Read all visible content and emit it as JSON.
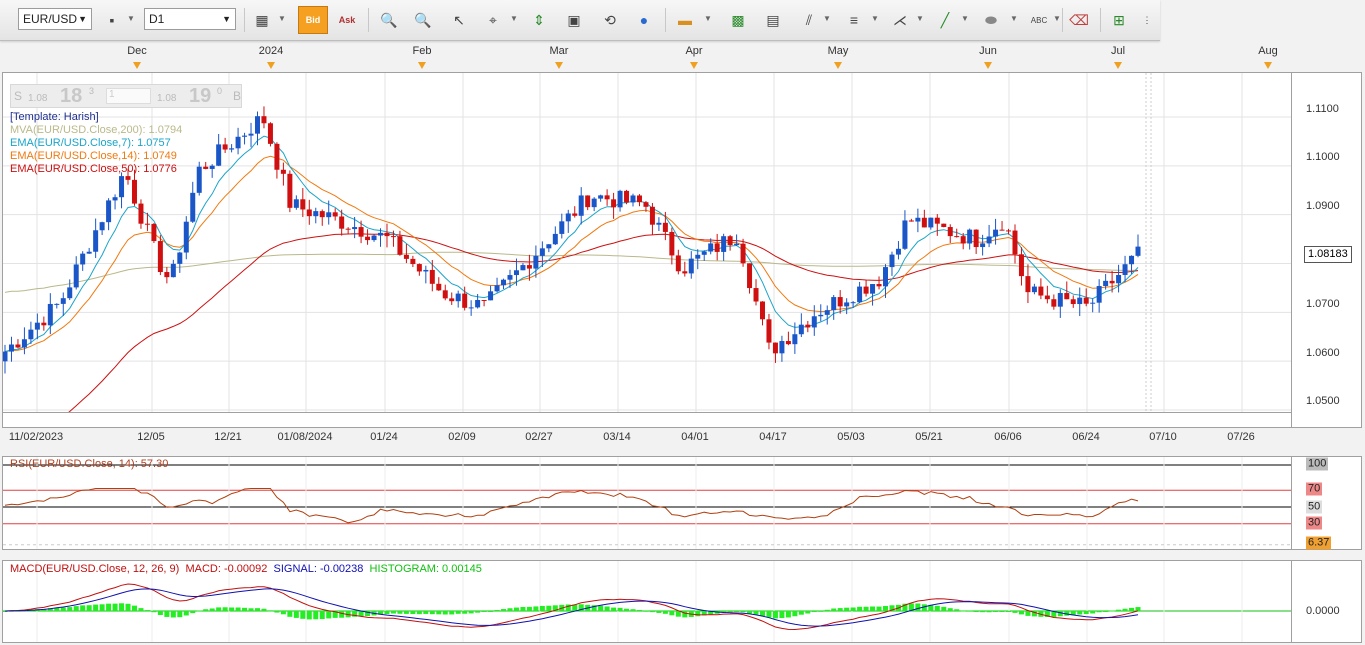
{
  "toolbar": {
    "symbol": "EUR/USD",
    "timeframe": "D1",
    "bid_label": "Bid",
    "ask_label": "Ask"
  },
  "timeline": {
    "months": [
      "Dec",
      "2024",
      "Feb",
      "Mar",
      "Apr",
      "May",
      "Jun",
      "Jul",
      "Aug"
    ]
  },
  "quote": {
    "sell_label": "S",
    "sell_small": "1.08",
    "sell_big": "18",
    "sell_sup": "3",
    "amount": "1",
    "buy_small": "1.08",
    "buy_big": "19",
    "buy_sup": "0",
    "buy_label": "B"
  },
  "price_chart": {
    "legend": [
      {
        "text": "[Template: Harish]",
        "color": "#1f2f8f"
      },
      {
        "text": "MVA(EUR/USD.Close,200): 1.0794",
        "color": "#b9b98a"
      },
      {
        "text": "EMA(EUR/USD.Close,7): 1.0757",
        "color": "#1aa4c9"
      },
      {
        "text": "EMA(EUR/USD.Close,14): 1.0749",
        "color": "#f07a10"
      },
      {
        "text": "EMA(EUR/USD.Close,50): 1.0776",
        "color": "#cc1111"
      }
    ],
    "current_price": "1.08183",
    "y_ticks": [
      "1.1100",
      "1.1000",
      "1.0900",
      "1.0800",
      "1.0700",
      "1.0600",
      "1.0500"
    ],
    "x_ticks": [
      "11/02/2023",
      "12/05",
      "12/21",
      "01/08/2024",
      "01/24",
      "02/09",
      "02/27",
      "03/14",
      "04/01",
      "04/17",
      "05/03",
      "05/21",
      "06/06",
      "06/24",
      "07/10",
      "07/26"
    ]
  },
  "rsi": {
    "label": "RSI(EUR/USD.Close, 14): 57.30",
    "levels": [
      "100",
      "70",
      "50",
      "30"
    ],
    "current": "6.37"
  },
  "macd": {
    "label": "MACD(EUR/USD.Close, 12, 26, 9)",
    "macd_value": "MACD: -0.00092",
    "signal_value": "SIGNAL: -0.00238",
    "histogram_value": "HISTOGRAM: 0.00145",
    "zero_label": "0.0000"
  },
  "chart_data": {
    "type": "candlestick",
    "symbol": "EUR/USD",
    "timeframe": "D1",
    "y_range": [
      1.05,
      1.115
    ],
    "x_range": [
      "2023-11-02",
      "2024-07-31"
    ],
    "closes_approx": [
      {
        "date": "2023-11-02",
        "close": 1.062
      },
      {
        "date": "2023-11-14",
        "close": 1.072
      },
      {
        "date": "2023-11-28",
        "close": 1.099
      },
      {
        "date": "2023-12-05",
        "close": 1.081
      },
      {
        "date": "2023-12-08",
        "close": 1.076
      },
      {
        "date": "2023-12-14",
        "close": 1.099
      },
      {
        "date": "2023-12-28",
        "close": 1.11
      },
      {
        "date": "2024-01-03",
        "close": 1.092
      },
      {
        "date": "2024-01-16",
        "close": 1.088
      },
      {
        "date": "2024-01-24",
        "close": 1.085
      },
      {
        "date": "2024-02-05",
        "close": 1.074
      },
      {
        "date": "2024-02-14",
        "close": 1.071
      },
      {
        "date": "2024-02-27",
        "close": 1.084
      },
      {
        "date": "2024-03-08",
        "close": 1.094
      },
      {
        "date": "2024-03-20",
        "close": 1.092
      },
      {
        "date": "2024-03-28",
        "close": 1.079
      },
      {
        "date": "2024-04-09",
        "close": 1.086
      },
      {
        "date": "2024-04-16",
        "close": 1.062
      },
      {
        "date": "2024-04-26",
        "close": 1.07
      },
      {
        "date": "2024-05-10",
        "close": 1.077
      },
      {
        "date": "2024-05-16",
        "close": 1.089
      },
      {
        "date": "2024-05-31",
        "close": 1.085
      },
      {
        "date": "2024-06-06",
        "close": 1.089
      },
      {
        "date": "2024-06-11",
        "close": 1.074
      },
      {
        "date": "2024-06-24",
        "close": 1.071
      },
      {
        "date": "2024-07-05",
        "close": 1.0818
      }
    ],
    "indicators": {
      "MVA200": 1.0794,
      "EMA7": 1.0757,
      "EMA14": 1.0749,
      "EMA50": 1.0776,
      "RSI14": 57.3,
      "MACD": -0.00092,
      "SIGNAL": -0.00238,
      "HISTOGRAM": 0.00145
    }
  }
}
